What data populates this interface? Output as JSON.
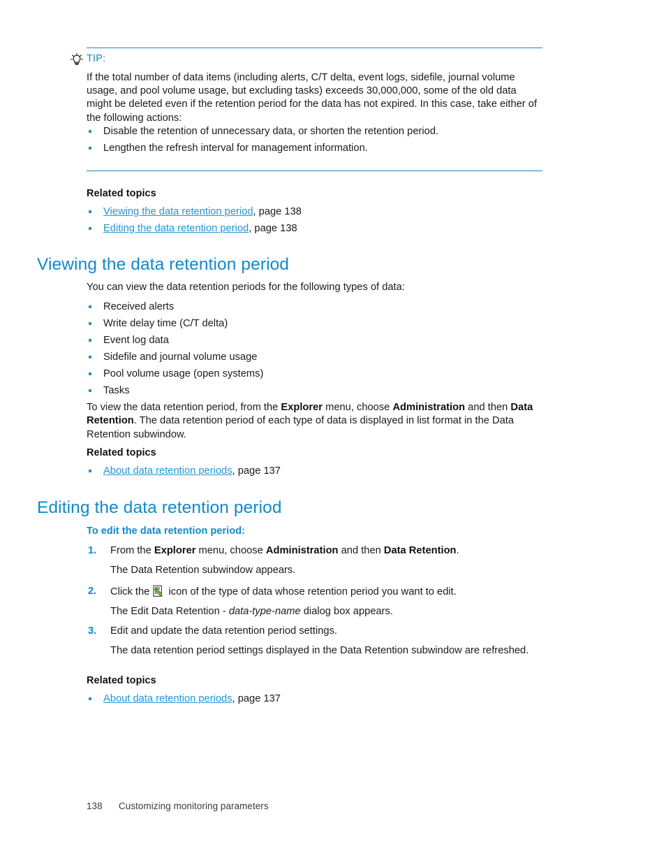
{
  "tip": {
    "icon": "lightbulb-icon",
    "label": "TIP:",
    "body": "If the total number of data items (including alerts, C/T delta, event logs, sidefile, journal volume usage, and pool volume usage, but excluding tasks) exceeds 30,000,000, some of the old data might be deleted even if the retention period for the data has not expired. In this case, take either of the following actions:",
    "bullets": [
      "Disable the retention of unnecessary data, or shorten the retention period.",
      "Lengthen the refresh interval for management information."
    ]
  },
  "related_top": {
    "title": "Related topics",
    "items": [
      {
        "link": "Viewing the data retention period",
        "suffix": ", page 138"
      },
      {
        "link": "Editing the data retention period",
        "suffix": ", page 138"
      }
    ]
  },
  "viewing_section": {
    "heading": "Viewing the data retention period",
    "intro": "You can view the data retention periods for the following types of data:",
    "types": [
      "Received alerts",
      "Write delay time (C/T delta)",
      "Event log data",
      "Sidefile and journal volume usage",
      "Pool volume usage (open systems)",
      "Tasks"
    ],
    "paragraph": {
      "p1": "To view the data retention period, from the ",
      "b1": "Explorer",
      "p2": " menu, choose ",
      "b2": "Administration",
      "p3": " and then ",
      "b3": "Data Retention",
      "p4": ". The data retention period of each type of data is displayed in list format in the Data Retention subwindow."
    },
    "related": {
      "title": "Related topics",
      "items": [
        {
          "link": "About data retention periods",
          "suffix": ", page 137"
        }
      ]
    }
  },
  "editing_section": {
    "heading": "Editing the data retention period",
    "procedure_title": "To edit the data retention period:",
    "steps": [
      {
        "num": "1.",
        "p1": "From the ",
        "b1": "Explorer",
        "p2": " menu, choose ",
        "b2": "Administration",
        "p3": " and then ",
        "b3": "Data Retention",
        "p4": ".",
        "sub_p1": "The Data Retention subwindow appears."
      },
      {
        "num": "2.",
        "p1": "Click the ",
        "icon": "edit-document-icon",
        "p2": " icon of the type of data whose retention period you want to edit.",
        "sub_p1": "The Edit Data Retention - ",
        "sub_i1": "data-type-name",
        "sub_p2": " dialog box appears."
      },
      {
        "num": "3.",
        "p1": "Edit and update the data retention period settings.",
        "sub_p1": "The data retention period settings displayed in the Data Retention subwindow are refreshed."
      }
    ],
    "related": {
      "title": "Related topics",
      "items": [
        {
          "link": "About data retention periods",
          "suffix": ", page 137"
        }
      ]
    }
  },
  "footer": {
    "page_number": "138",
    "chapter": "Customizing monitoring parameters"
  },
  "colors": {
    "accent_blue": "#1189c9",
    "rule_blue": "#0f8cc4",
    "link_blue": "#2396d4",
    "body_text": "#1b1b1b"
  }
}
